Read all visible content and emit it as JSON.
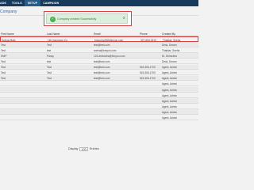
{
  "nav": {
    "items": [
      "ADS",
      "TOOLS",
      "SETUP",
      "CAMPAIGN"
    ],
    "active": 2
  },
  "page": {
    "title": "Company"
  },
  "toast": {
    "message": "Company created Successfully",
    "close": "x",
    "check": "✓"
  },
  "table": {
    "headers": [
      "First Name",
      "Last Name",
      "Email",
      "Phone",
      "Created By"
    ],
    "rows": [
      [
        "Swingy Bats",
        "Life Insurance Co",
        "bmurphy@lifebmyon.com",
        "307-654-3210",
        "Thakkar, Sneha"
      ],
      [
        "Test",
        "Test",
        "test@test.com",
        "",
        "Desk, Dream"
      ],
      [
        "Test",
        "test",
        "sneha@bmyon.com",
        "",
        "Thakkar, Sneha"
      ],
      [
        "SNIP",
        "Pansy",
        "123-dhimraha@bmyon.com",
        "",
        "Dr. Dhimraha"
      ],
      [
        "Test",
        "test",
        "test@test.com",
        "",
        "Desk, Dream"
      ],
      [
        "Test",
        "Test",
        "test@test.com",
        "515-306-1700",
        "Agent, Admin"
      ],
      [
        "Test",
        "Test",
        "test@test.com",
        "515-306-1700",
        "Agent, Admin"
      ],
      [
        "Test",
        "Test",
        "test@test.com",
        "515-306-1700",
        "Agent, Admin"
      ],
      [
        "",
        "",
        "",
        "",
        "Agent, Admin"
      ],
      [
        "",
        "",
        "",
        "",
        "Agent, Admin"
      ],
      [
        "",
        "",
        "",
        "",
        "Agent, Admin"
      ],
      [
        "",
        "",
        "",
        "",
        "Agent, Admin"
      ],
      [
        "",
        "",
        "",
        "",
        "Agent, Admin"
      ],
      [
        "",
        "",
        "",
        "",
        "Agent, Admin"
      ],
      [
        "",
        "",
        "",
        "",
        "Agent, Admin"
      ]
    ]
  },
  "pager": {
    "display_label": "Display",
    "page_size": "100",
    "entries_label": "Entries"
  }
}
